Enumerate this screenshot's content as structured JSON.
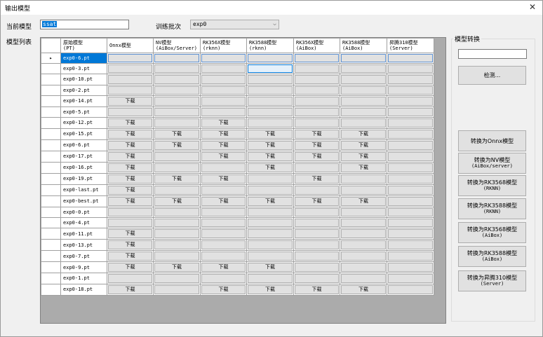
{
  "window": {
    "title": "输出模型",
    "close_icon": "✕"
  },
  "labels": {
    "current_model": "当前模型",
    "training_batch": "训练批次",
    "model_list": "模型列表"
  },
  "model_input": {
    "value": "ssat"
  },
  "batch_combo": {
    "value": "exp0",
    "arrow": "⌵"
  },
  "grid": {
    "row_marker": "▸",
    "headers": [
      {
        "line1": "原始模型",
        "line2": "(PT)"
      },
      {
        "line1": "Onnx模型",
        "line2": ""
      },
      {
        "line1": "NV模型",
        "line2": "(AiBox/Server)"
      },
      {
        "line1": "RK356X模型",
        "line2": "(rknn)"
      },
      {
        "line1": "RK3588模型",
        "line2": "(rknn)"
      },
      {
        "line1": "RK356X模型",
        "line2": "(AiBox)"
      },
      {
        "line1": "RK3588模型",
        "line2": "(AiBox)"
      },
      {
        "line1": "昇腾310模型",
        "line2": "(Server)"
      }
    ],
    "download_label": "下载",
    "rows": [
      {
        "name": "exp0-6.pt",
        "cells": [
          0,
          0,
          0,
          0,
          0,
          0,
          0
        ]
      },
      {
        "name": "exp0-3.pt",
        "cells": [
          0,
          0,
          0,
          0,
          0,
          0,
          0
        ]
      },
      {
        "name": "exp0-10.pt",
        "cells": [
          0,
          0,
          0,
          0,
          0,
          0,
          0
        ]
      },
      {
        "name": "exp0-2.pt",
        "cells": [
          0,
          0,
          0,
          0,
          0,
          0,
          0
        ]
      },
      {
        "name": "exp0-14.pt",
        "cells": [
          1,
          0,
          0,
          0,
          0,
          0,
          0
        ]
      },
      {
        "name": "exp0-5.pt",
        "cells": [
          0,
          0,
          0,
          0,
          0,
          0,
          0
        ]
      },
      {
        "name": "exp0-12.pt",
        "cells": [
          1,
          0,
          1,
          0,
          0,
          0,
          0
        ]
      },
      {
        "name": "exp0-15.pt",
        "cells": [
          1,
          1,
          1,
          1,
          1,
          1,
          0
        ]
      },
      {
        "name": "exp0-6.pt",
        "cells": [
          1,
          1,
          1,
          1,
          1,
          1,
          0
        ]
      },
      {
        "name": "exp0-17.pt",
        "cells": [
          1,
          0,
          1,
          1,
          1,
          1,
          0
        ]
      },
      {
        "name": "exp0-16.pt",
        "cells": [
          1,
          0,
          0,
          1,
          0,
          1,
          0
        ]
      },
      {
        "name": "exp0-19.pt",
        "cells": [
          1,
          1,
          1,
          0,
          1,
          0,
          0
        ]
      },
      {
        "name": "exp0-last.pt",
        "cells": [
          1,
          0,
          0,
          0,
          0,
          0,
          0
        ]
      },
      {
        "name": "exp0-best.pt",
        "cells": [
          1,
          1,
          1,
          1,
          1,
          1,
          0
        ]
      },
      {
        "name": "exp0-0.pt",
        "cells": [
          0,
          0,
          0,
          0,
          0,
          0,
          0
        ]
      },
      {
        "name": "exp0-4.pt",
        "cells": [
          0,
          0,
          0,
          0,
          0,
          0,
          0
        ]
      },
      {
        "name": "exp0-11.pt",
        "cells": [
          1,
          0,
          0,
          0,
          0,
          0,
          0
        ]
      },
      {
        "name": "exp0-13.pt",
        "cells": [
          1,
          0,
          0,
          0,
          0,
          0,
          0
        ]
      },
      {
        "name": "exp0-7.pt",
        "cells": [
          1,
          0,
          0,
          0,
          0,
          0,
          0
        ]
      },
      {
        "name": "exp0-9.pt",
        "cells": [
          1,
          1,
          1,
          1,
          0,
          0,
          0
        ]
      },
      {
        "name": "exp0-1.pt",
        "cells": [
          0,
          0,
          0,
          0,
          0,
          0,
          0
        ]
      },
      {
        "name": "exp0-18.pt",
        "cells": [
          1,
          0,
          1,
          1,
          1,
          1,
          0
        ]
      }
    ]
  },
  "convert_panel": {
    "title": "模型转换",
    "detect_label": "检测...",
    "buttons": [
      {
        "line1": "转换为Onnx模型",
        "line2": ""
      },
      {
        "line1": "转换为NV模型",
        "line2": "(AiBox/server)"
      },
      {
        "line1": "转换为RK3568模型",
        "line2": "(RKNN)"
      },
      {
        "line1": "转换为RK3588模型",
        "line2": "(RKNN)"
      },
      {
        "line1": "转换为RK3568模型",
        "line2": "(AiBox)"
      },
      {
        "line1": "转换为RK3588模型",
        "line2": "(AiBox)"
      },
      {
        "line1": "转换为昇腾310模型",
        "line2": "(Server)"
      }
    ]
  }
}
